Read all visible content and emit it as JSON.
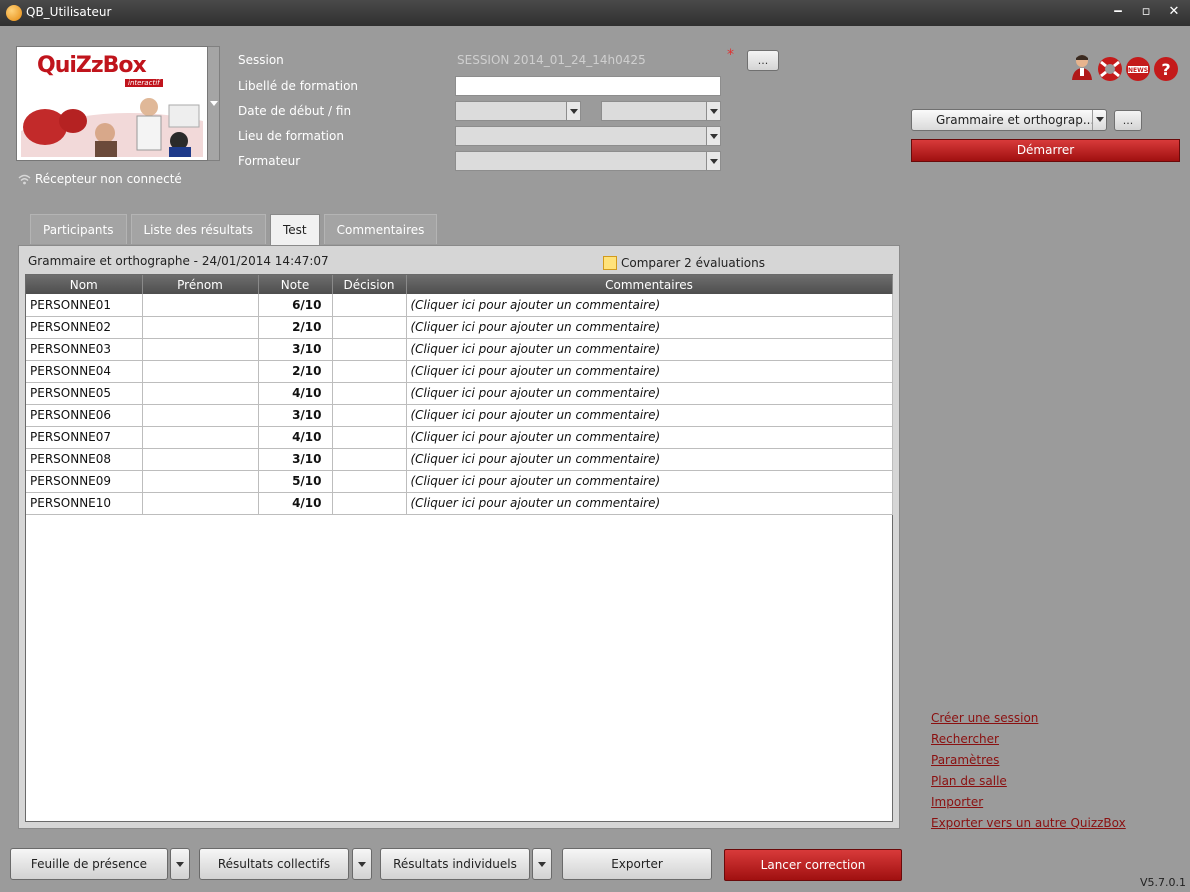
{
  "window": {
    "title": "QB_Utilisateur",
    "controls": {
      "minimize": "‒",
      "maximize": "▫",
      "close": "✕"
    }
  },
  "logo": {
    "brand": "QuiZzBox",
    "tagline": "interactif"
  },
  "receiver_status": "Récepteur non connecté",
  "form": {
    "session_label": "Session",
    "session_value": "SESSION 2014_01_24_14h0425",
    "required_mark": "*",
    "session_dots": "...",
    "libelle_label": "Libellé de formation",
    "libelle_value": "",
    "dates_label": "Date de début / fin",
    "lieu_label": "Lieu de formation",
    "formateur_label": "Formateur"
  },
  "toolbar": {
    "icons": [
      "user-icon",
      "life-ring-icon",
      "news-icon",
      "help-icon"
    ]
  },
  "test_panel": {
    "selected_test": "Grammaire et orthograp...",
    "dots": "...",
    "start_label": "Démarrer"
  },
  "tabs": [
    {
      "label": "Participants",
      "active": false
    },
    {
      "label": "Liste des résultats",
      "active": false
    },
    {
      "label": "Test",
      "active": true
    },
    {
      "label": "Commentaires",
      "active": false
    }
  ],
  "results": {
    "title": "Grammaire et orthographe - 24/01/2014 14:47:07",
    "compare_label": "Comparer 2 évaluations",
    "columns": [
      "Nom",
      "Prénom",
      "Note",
      "Décision",
      "Commentaires"
    ],
    "rows": [
      {
        "nom": "PERSONNE01",
        "prenom": "",
        "note": "6/10",
        "decision": "",
        "comment": "(Cliquer ici pour ajouter un commentaire)"
      },
      {
        "nom": "PERSONNE02",
        "prenom": "",
        "note": "2/10",
        "decision": "",
        "comment": "(Cliquer ici pour ajouter un commentaire)"
      },
      {
        "nom": "PERSONNE03",
        "prenom": "",
        "note": "3/10",
        "decision": "",
        "comment": "(Cliquer ici pour ajouter un commentaire)"
      },
      {
        "nom": "PERSONNE04",
        "prenom": "",
        "note": "2/10",
        "decision": "",
        "comment": "(Cliquer ici pour ajouter un commentaire)"
      },
      {
        "nom": "PERSONNE05",
        "prenom": "",
        "note": "4/10",
        "decision": "",
        "comment": "(Cliquer ici pour ajouter un commentaire)"
      },
      {
        "nom": "PERSONNE06",
        "prenom": "",
        "note": "3/10",
        "decision": "",
        "comment": "(Cliquer ici pour ajouter un commentaire)"
      },
      {
        "nom": "PERSONNE07",
        "prenom": "",
        "note": "4/10",
        "decision": "",
        "comment": "(Cliquer ici pour ajouter un commentaire)"
      },
      {
        "nom": "PERSONNE08",
        "prenom": "",
        "note": "3/10",
        "decision": "",
        "comment": "(Cliquer ici pour ajouter un commentaire)"
      },
      {
        "nom": "PERSONNE09",
        "prenom": "",
        "note": "5/10",
        "decision": "",
        "comment": "(Cliquer ici pour ajouter un commentaire)"
      },
      {
        "nom": "PERSONNE10",
        "prenom": "",
        "note": "4/10",
        "decision": "",
        "comment": "(Cliquer ici pour ajouter un commentaire)"
      }
    ]
  },
  "side_links": [
    "Créer une session",
    "Rechercher",
    "Paramètres",
    "Plan de salle",
    "Importer",
    "Exporter vers un autre QuizzBox"
  ],
  "bottom_bar": {
    "feuille_label": "Feuille de présence",
    "collectifs_label": "Résultats collectifs",
    "individuels_label": "Résultats individuels",
    "exporter_label": "Exporter",
    "launch_label": "Lancer correction"
  },
  "version": "V5.7.0.1",
  "colors": {
    "accent_red": "#b51c1c",
    "window_bg": "#9b9b9b",
    "grid_header": "#5a5a5a"
  }
}
